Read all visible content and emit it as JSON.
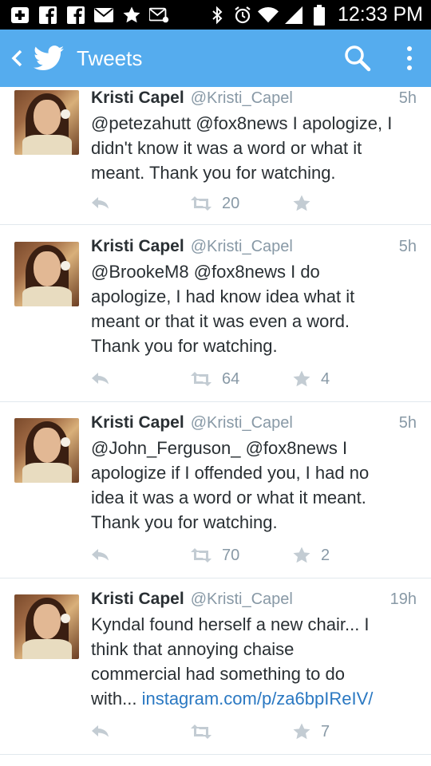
{
  "status_bar": {
    "time": "12:33 PM"
  },
  "action_bar": {
    "title": "Tweets"
  },
  "tweets": [
    {
      "name": "Kristi Capel",
      "handle": "@Kristi_Capel",
      "time": "5h",
      "lines": [
        "@petezahutt @fox8news I apologize, I",
        "didn't know it was a word or what it",
        "meant. Thank you for watching."
      ],
      "retweets": "20",
      "favorites": ""
    },
    {
      "name": "Kristi Capel",
      "handle": "@Kristi_Capel",
      "time": "5h",
      "lines": [
        "@BrookeM8 @fox8news I do",
        "apologize, I had know idea what it",
        "meant or that it was even a word.",
        "Thank you for watching."
      ],
      "retweets": "64",
      "favorites": "4"
    },
    {
      "name": "Kristi Capel",
      "handle": "@Kristi_Capel",
      "time": "5h",
      "lines": [
        "@John_Ferguson_ @fox8news I",
        "apologize if I offended you, I had no",
        "idea it was a word or what it meant.",
        "Thank you for watching."
      ],
      "retweets": "70",
      "favorites": "2"
    },
    {
      "name": "Kristi Capel",
      "handle": "@Kristi_Capel",
      "time": "19h",
      "lines": [
        "Kyndal found herself a new chair... I",
        "think that annoying chaise",
        "commercial had something to do"
      ],
      "last_line_prefix": "with... ",
      "last_line_link": "instagram.com/p/za6bpIReIV/",
      "retweets": "",
      "favorites": "7"
    }
  ],
  "colors": {
    "action_bar": "#55acee",
    "text": "#292f33",
    "muted": "#8899a6",
    "link": "#2a78c2",
    "action_icon": "#b5c2cc"
  },
  "icons": {
    "status_left": [
      "add-box-icon",
      "facebook-icon",
      "facebook-icon",
      "mail-icon",
      "star-icon",
      "voicemail-icon"
    ],
    "status_right": [
      "bluetooth-icon",
      "alarm-icon",
      "wifi-icon",
      "signal-icon",
      "battery-icon"
    ],
    "action_bar": [
      "back-arrow-icon",
      "twitter-bird-icon",
      "search-icon",
      "overflow-menu-icon"
    ],
    "tweet_actions": [
      "reply-icon",
      "retweet-icon",
      "favorite-star-icon"
    ]
  }
}
